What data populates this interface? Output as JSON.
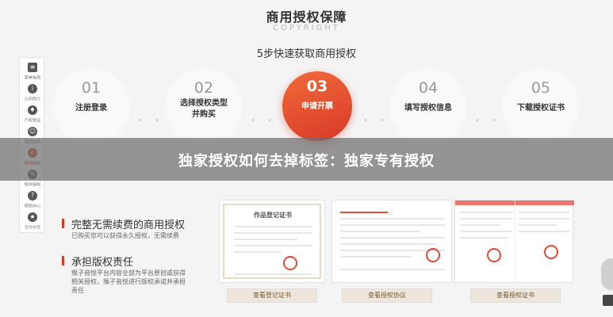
{
  "header": {
    "title": "商用授权保障",
    "subtitle": "COPYRIGHT",
    "tagline": "5步快速获取商用授权"
  },
  "sidebar": {
    "items": [
      {
        "label": "菜单指南",
        "icon": "menu-icon"
      },
      {
        "label": "公司简介",
        "icon": "info-icon"
      },
      {
        "label": "产权保证",
        "icon": "shield-icon"
      },
      {
        "label": "售后指南",
        "icon": "service-icon"
      },
      {
        "label": "商用授权",
        "icon": "certificate-icon"
      },
      {
        "label": "制作授权",
        "icon": "edit-icon"
      },
      {
        "label": "帮助中心",
        "icon": "help-icon"
      },
      {
        "label": "合作伙伴",
        "icon": "partner-icon"
      }
    ]
  },
  "steps": [
    {
      "num": "01",
      "label": "注册登录"
    },
    {
      "num": "02",
      "label_line1": "选择授权类型",
      "label_line2": "并购买"
    },
    {
      "num": "03",
      "label": "申请开票"
    },
    {
      "num": "04",
      "label": "填写授权信息"
    },
    {
      "num": "05",
      "label": "下载授权证书"
    }
  ],
  "banner": {
    "text": "独家授权如何去掉标签：独家专有授权"
  },
  "features": [
    {
      "title": "完整无需续费的商用授权",
      "desc1": "已购买您可以获得永久授权，无需续费"
    },
    {
      "title": "承担版权责任",
      "desc1": "猴子音悦平台内容全部为平台原创或获得",
      "desc2": "相关授权，猴子音悦进行版权承诺并承担",
      "desc3": "责任"
    }
  ],
  "documents": [
    {
      "heading": "作品登记证书",
      "button": "查看登记证书"
    },
    {
      "heading": "",
      "button": "查看授权协议"
    },
    {
      "heading": "",
      "button": "查看授权证书"
    }
  ],
  "colors": {
    "accent": "#d83a26",
    "banner_overlay": "#6e6e6e"
  }
}
